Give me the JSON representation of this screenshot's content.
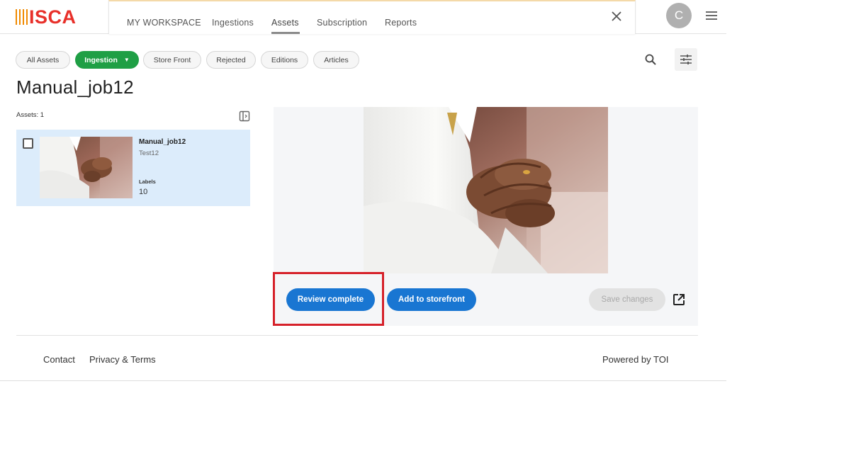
{
  "brand": {
    "logo_text": "ISCA"
  },
  "nav": {
    "items": [
      {
        "label": "MY WORKSPACE"
      },
      {
        "label": "Ingestions"
      },
      {
        "label": "Assets"
      },
      {
        "label": "Subscription"
      },
      {
        "label": "Reports"
      }
    ],
    "active": "Assets"
  },
  "user": {
    "avatar_initial": "C"
  },
  "filters": {
    "chips": [
      {
        "label": "All Assets"
      },
      {
        "label": "Ingestion"
      },
      {
        "label": "Store Front"
      },
      {
        "label": "Rejected"
      },
      {
        "label": "Editions"
      },
      {
        "label": "Articles"
      }
    ],
    "active": "Ingestion"
  },
  "page": {
    "title": "Manual_job12",
    "assets_count": "Assets: 1"
  },
  "asset": {
    "name": "Manual_job12",
    "sub": "Test12",
    "labels_heading": "Labels",
    "labels_value": "10",
    "checked": false
  },
  "actions": {
    "review_complete": "Review complete",
    "add_to_storefront": "Add to storefront",
    "save_changes": "Save changes"
  },
  "footer": {
    "contact": "Contact",
    "privacy": "Privacy & Terms",
    "powered": "Powered by TOI"
  },
  "icons": {
    "close": "close-icon",
    "menu": "hamburger-menu-icon",
    "search": "search-icon",
    "filter": "filter-sliders-icon",
    "panel_toggle": "panel-toggle-icon",
    "open_external": "open-in-new-icon"
  },
  "colors": {
    "brand_red": "#e8302a",
    "brand_orange": "#f08a00",
    "active_chip": "#1f9f45",
    "primary_button": "#1976d2",
    "selected_card": "#dcecfb",
    "highlight": "#d6212a"
  }
}
